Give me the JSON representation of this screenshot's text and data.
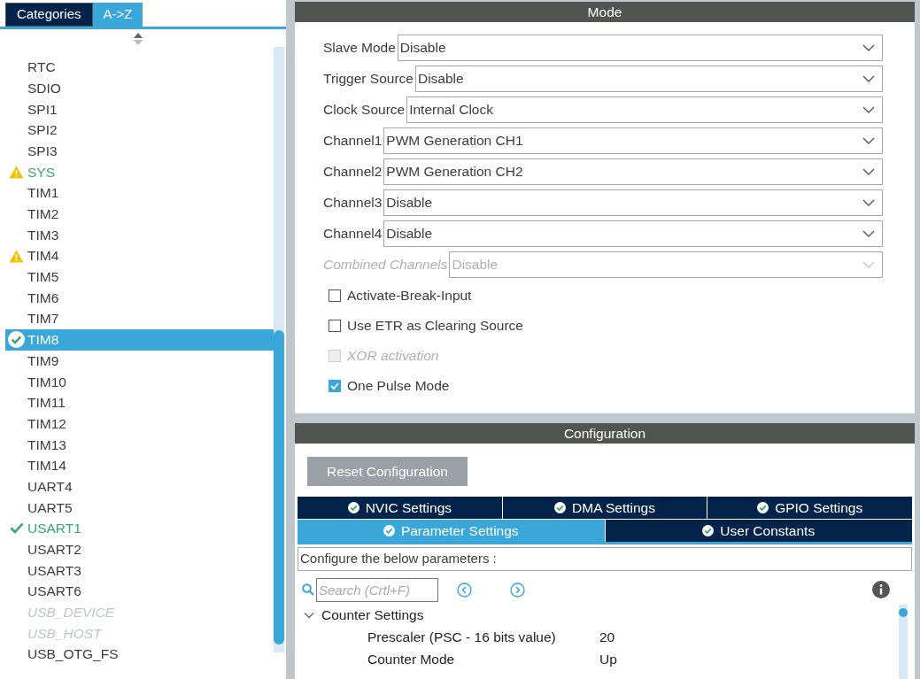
{
  "sidebar": {
    "tabs": [
      {
        "label": "Categories",
        "selected": false
      },
      {
        "label": "A->Z",
        "selected": true
      }
    ],
    "items": [
      {
        "label": "RTC",
        "kind": "plain",
        "configured": false,
        "disabled": false,
        "selected": false
      },
      {
        "label": "SDIO",
        "kind": "plain",
        "configured": false,
        "disabled": false,
        "selected": false
      },
      {
        "label": "SPI1",
        "kind": "plain",
        "configured": false,
        "disabled": false,
        "selected": false
      },
      {
        "label": "SPI2",
        "kind": "plain",
        "configured": false,
        "disabled": false,
        "selected": false
      },
      {
        "label": "SPI3",
        "kind": "plain",
        "configured": false,
        "disabled": false,
        "selected": false
      },
      {
        "label": "SYS",
        "kind": "warning",
        "configured": true,
        "disabled": false,
        "selected": false
      },
      {
        "label": "TIM1",
        "kind": "plain",
        "configured": false,
        "disabled": false,
        "selected": false
      },
      {
        "label": "TIM2",
        "kind": "plain",
        "configured": false,
        "disabled": false,
        "selected": false
      },
      {
        "label": "TIM3",
        "kind": "plain",
        "configured": false,
        "disabled": false,
        "selected": false
      },
      {
        "label": "TIM4",
        "kind": "warning",
        "configured": false,
        "disabled": false,
        "selected": false
      },
      {
        "label": "TIM5",
        "kind": "plain",
        "configured": false,
        "disabled": false,
        "selected": false
      },
      {
        "label": "TIM6",
        "kind": "plain",
        "configured": false,
        "disabled": false,
        "selected": false
      },
      {
        "label": "TIM7",
        "kind": "plain",
        "configured": false,
        "disabled": false,
        "selected": false
      },
      {
        "label": "TIM8",
        "kind": "check-circle",
        "configured": false,
        "disabled": false,
        "selected": true
      },
      {
        "label": "TIM9",
        "kind": "plain",
        "configured": false,
        "disabled": false,
        "selected": false
      },
      {
        "label": "TIM10",
        "kind": "plain",
        "configured": false,
        "disabled": false,
        "selected": false
      },
      {
        "label": "TIM11",
        "kind": "plain",
        "configured": false,
        "disabled": false,
        "selected": false
      },
      {
        "label": "TIM12",
        "kind": "plain",
        "configured": false,
        "disabled": false,
        "selected": false
      },
      {
        "label": "TIM13",
        "kind": "plain",
        "configured": false,
        "disabled": false,
        "selected": false
      },
      {
        "label": "TIM14",
        "kind": "plain",
        "configured": false,
        "disabled": false,
        "selected": false
      },
      {
        "label": "UART4",
        "kind": "plain",
        "configured": false,
        "disabled": false,
        "selected": false
      },
      {
        "label": "UART5",
        "kind": "plain",
        "configured": false,
        "disabled": false,
        "selected": false
      },
      {
        "label": "USART1",
        "kind": "check",
        "configured": true,
        "disabled": false,
        "selected": false
      },
      {
        "label": "USART2",
        "kind": "plain",
        "configured": false,
        "disabled": false,
        "selected": false
      },
      {
        "label": "USART3",
        "kind": "plain",
        "configured": false,
        "disabled": false,
        "selected": false
      },
      {
        "label": "USART6",
        "kind": "plain",
        "configured": false,
        "disabled": false,
        "selected": false
      },
      {
        "label": "USB_DEVICE",
        "kind": "plain",
        "configured": false,
        "disabled": true,
        "selected": false
      },
      {
        "label": "USB_HOST",
        "kind": "plain",
        "configured": false,
        "disabled": true,
        "selected": false
      },
      {
        "label": "USB_OTG_FS",
        "kind": "plain",
        "configured": false,
        "disabled": false,
        "selected": false
      }
    ]
  },
  "mode": {
    "title": "Mode",
    "fields": [
      {
        "label": "Slave Mode",
        "value": "Disable",
        "disabled": false
      },
      {
        "label": "Trigger Source",
        "value": "Disable",
        "disabled": false
      },
      {
        "label": "Clock Source",
        "value": "Internal Clock",
        "disabled": false
      },
      {
        "label": "Channel1",
        "value": "PWM Generation CH1",
        "disabled": false
      },
      {
        "label": "Channel2",
        "value": "PWM Generation CH2",
        "disabled": false
      },
      {
        "label": "Channel3",
        "value": "Disable",
        "disabled": false
      },
      {
        "label": "Channel4",
        "value": "Disable",
        "disabled": false
      },
      {
        "label": "Combined Channels",
        "value": "Disable",
        "disabled": true
      }
    ],
    "checkboxes": [
      {
        "label": "Activate-Break-Input",
        "checked": false,
        "disabled": false
      },
      {
        "label": "Use ETR as Clearing Source",
        "checked": false,
        "disabled": false
      },
      {
        "label": "XOR activation",
        "checked": false,
        "disabled": true
      },
      {
        "label": "One Pulse Mode",
        "checked": true,
        "disabled": false
      }
    ]
  },
  "configuration": {
    "title": "Configuration",
    "reset_button": "Reset Configuration",
    "tab_rows": [
      [
        {
          "label": "NVIC Settings",
          "selected": false
        },
        {
          "label": "DMA Settings",
          "selected": false
        },
        {
          "label": "GPIO Settings",
          "selected": false
        }
      ],
      [
        {
          "label": "Parameter Settings",
          "selected": true
        },
        {
          "label": "User Constants",
          "selected": false
        }
      ]
    ],
    "description": "Configure the below parameters :",
    "search": {
      "placeholder": "Search (Crtl+F)"
    },
    "tree": [
      {
        "label": "Counter Settings",
        "expanded": true,
        "children": [
          {
            "label": "Prescaler (PSC - 16 bits value)",
            "value": "20"
          },
          {
            "label": "Counter Mode",
            "value": "Up"
          }
        ]
      }
    ]
  }
}
